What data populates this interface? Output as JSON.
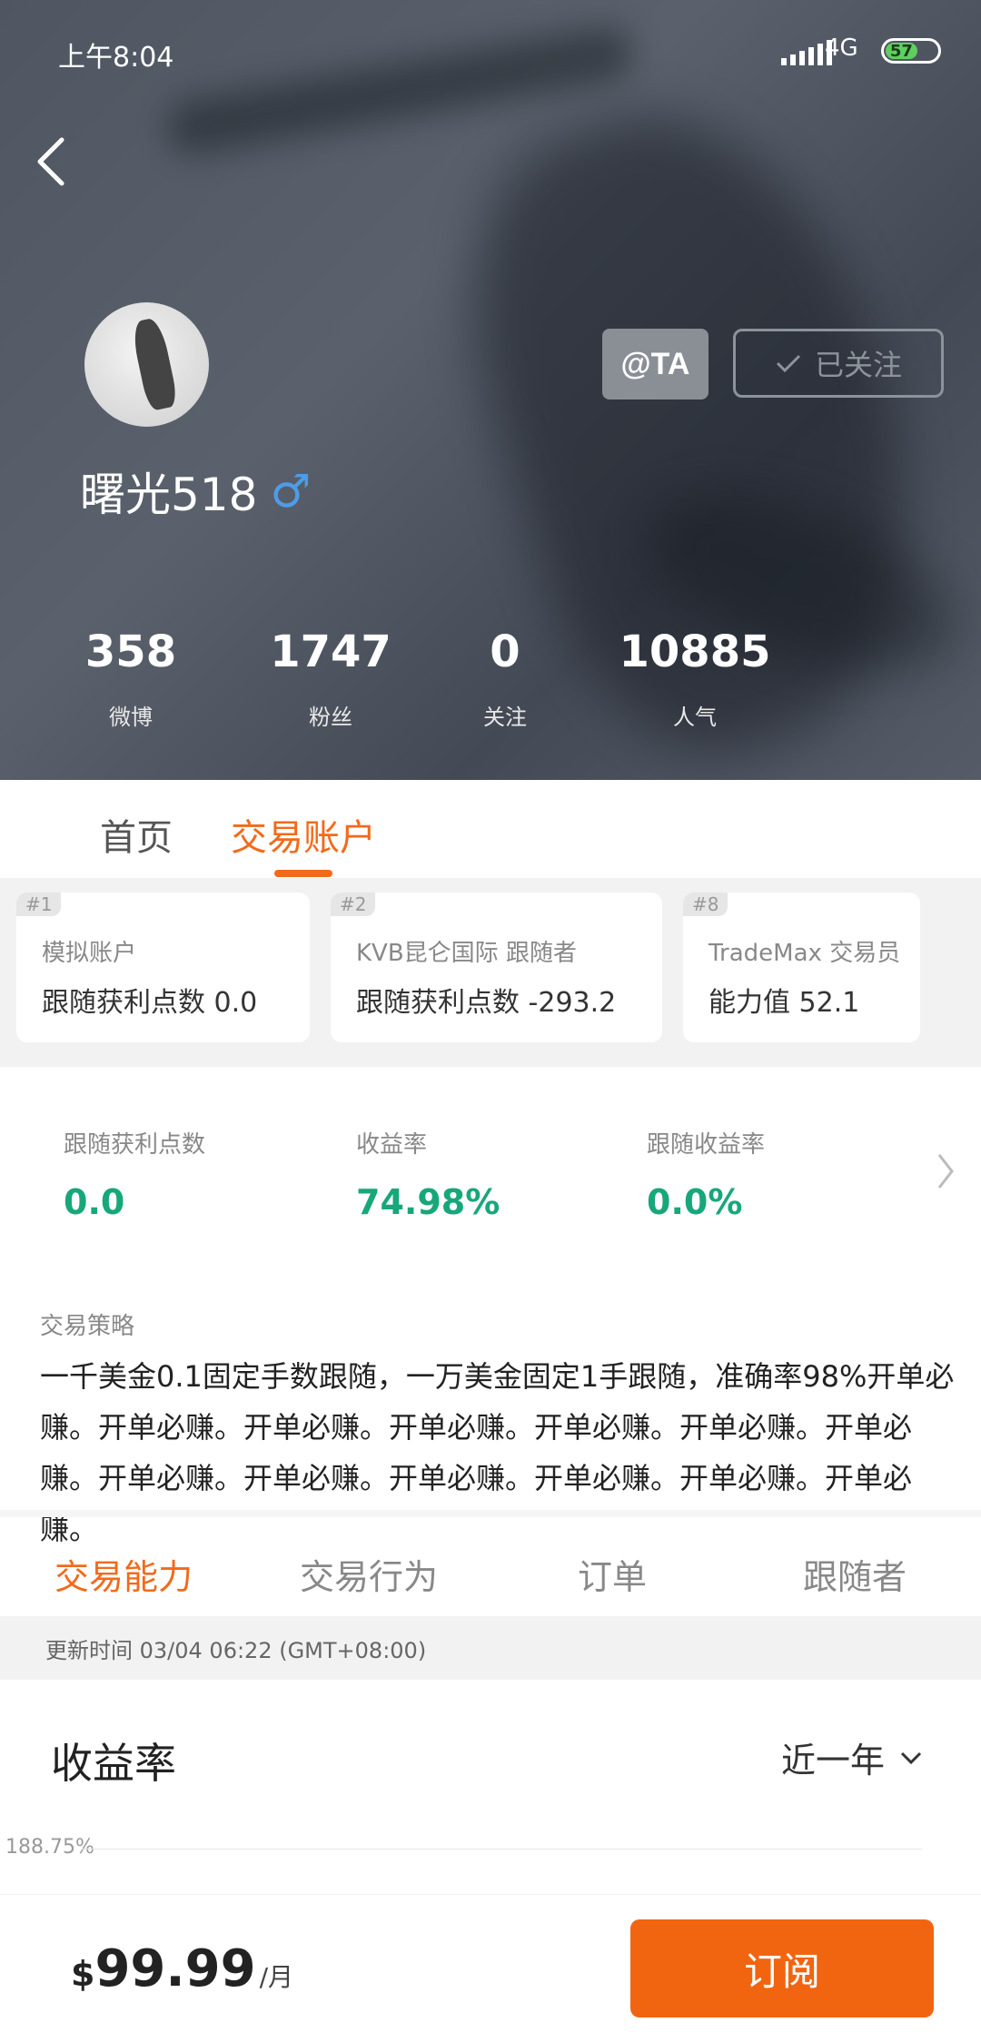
{
  "status_bar": {
    "time": "上午8:04",
    "network": "4G",
    "battery": "57"
  },
  "profile": {
    "name": "曙光518",
    "gender_symbol": "♂",
    "at_button": "@TA",
    "follow_button": "已关注",
    "stats": [
      {
        "value": "358",
        "label": "微博"
      },
      {
        "value": "1747",
        "label": "粉丝"
      },
      {
        "value": "0",
        "label": "关注"
      },
      {
        "value": "10885",
        "label": "人气"
      }
    ]
  },
  "top_tabs": [
    {
      "label": "首页"
    },
    {
      "label": "交易账户"
    }
  ],
  "accounts": [
    {
      "tag": "#1",
      "name": "模拟账户",
      "detail": "跟随获利点数 0.0"
    },
    {
      "tag": "#2",
      "name": "KVB昆仑国际 跟随者",
      "detail": "跟随获利点数 -293.2"
    },
    {
      "tag": "#8",
      "name": "TradeMax 交易员",
      "detail": "能力值 52.1"
    }
  ],
  "metrics": [
    {
      "label": "跟随获利点数",
      "value": "0.0"
    },
    {
      "label": "收益率",
      "value": "74.98%"
    },
    {
      "label": "跟随收益率",
      "value": "0.0%"
    }
  ],
  "strategy": {
    "title": "交易策略",
    "body": "一千美金0.1固定手数跟随，一万美金固定1手跟随，准确率98%开单必赚。开单必赚。开单必赚。开单必赚。开单必赚。开单必赚。开单必赚。开单必赚。开单必赚。开单必赚。开单必赚。开单必赚。开单必赚。"
  },
  "detail_tabs": [
    {
      "label": "交易能力"
    },
    {
      "label": "交易行为"
    },
    {
      "label": "订单"
    },
    {
      "label": "跟随者"
    }
  ],
  "update_time": "更新时间 03/04 06:22 (GMT+08:00)",
  "chart_section": {
    "title": "收益率",
    "period": "近一年",
    "top_tick": "188.75%"
  },
  "subscription": {
    "currency": "$",
    "price": "99.99",
    "unit": "/月",
    "button": "订阅"
  },
  "colors": {
    "accent": "#f26a1b",
    "positive": "#17a77a",
    "gender": "#4d9ce8"
  }
}
